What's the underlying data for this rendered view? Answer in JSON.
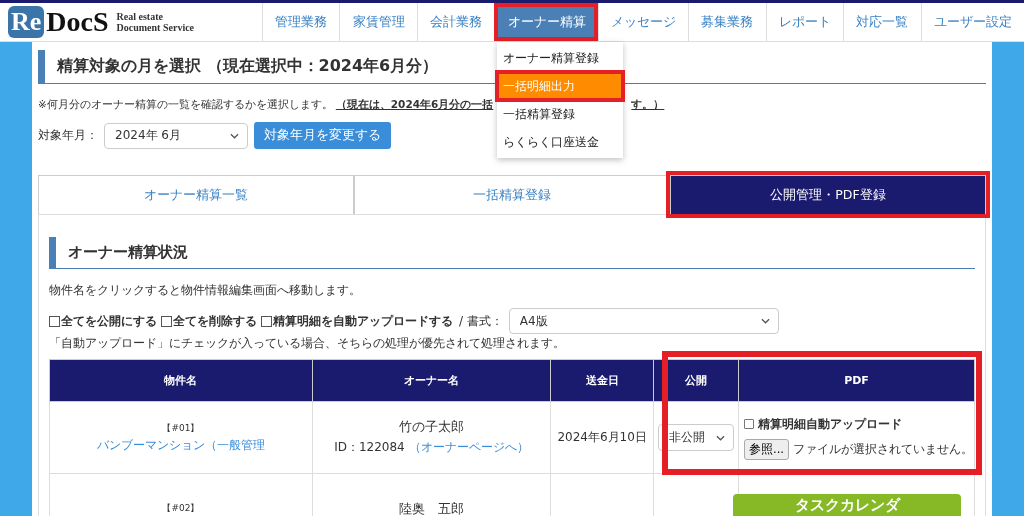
{
  "header": {
    "logo_mark": "Re",
    "logo_name": "DocS",
    "tagline_1": "Real estate",
    "tagline_2": "Document Service",
    "nav": [
      {
        "label": "管理業務",
        "selected": false,
        "highlighted": false
      },
      {
        "label": "家賃管理",
        "selected": false,
        "highlighted": false
      },
      {
        "label": "会計業務",
        "selected": false,
        "highlighted": false
      },
      {
        "label": "オーナー精算",
        "selected": true,
        "highlighted": true
      },
      {
        "label": "メッセージ",
        "selected": false,
        "highlighted": false
      },
      {
        "label": "募集業務",
        "selected": false,
        "highlighted": false
      },
      {
        "label": "レポート",
        "selected": false,
        "highlighted": false
      },
      {
        "label": "対応一覧",
        "selected": false,
        "highlighted": false
      },
      {
        "label": "ユーザー設定",
        "selected": false,
        "highlighted": false
      }
    ]
  },
  "dropdown": {
    "items": [
      {
        "label": "オーナー精算登録",
        "selected": false,
        "highlighted": false
      },
      {
        "label": "一括明細出力",
        "selected": true,
        "highlighted": true
      },
      {
        "label": "一括精算登録",
        "selected": false,
        "highlighted": false
      },
      {
        "label": "らくらく口座送金",
        "selected": false,
        "highlighted": false
      }
    ]
  },
  "month_section": {
    "title": "精算対象の月を選択 （現在選択中：2024年6月分）",
    "notice": "※何月分のオーナー精算の一覧を確認するかを選択します。",
    "notice_emphasis_start": "（現在は、2024年6月分の一括",
    "notice_emphasis_end": "す。）",
    "field_label": "対象年月：",
    "month_value": "2024年 6月",
    "change_button": "対象年月を変更する"
  },
  "tabs": [
    {
      "label": "オーナー精算一覧",
      "selected": false,
      "highlighted": false
    },
    {
      "label": "一括精算登録",
      "selected": false,
      "highlighted": false
    },
    {
      "label": "公開管理・PDF登録",
      "selected": true,
      "highlighted": true
    }
  ],
  "status_section": {
    "title": "オーナー精算状況",
    "hint": "物件名をクリックすると物件情報編集画面へ移動します。",
    "options": [
      {
        "label": "全てを公開にする",
        "checked": false
      },
      {
        "label": "全てを削除する",
        "checked": false
      },
      {
        "label": "精算明細を自動アップロードする",
        "checked": false
      }
    ],
    "format_label": "/ 書式：",
    "format_value": "A4版",
    "note": "「自動アップロード」にチェックが入っている場合、そちらの処理が優先されて処理されます。"
  },
  "table": {
    "highlight_frame": true,
    "columns": [
      "物件名",
      "オーナー名",
      "送金日",
      "公開",
      "PDF"
    ],
    "rows": [
      {
        "number": "【#01】",
        "property": "バンブーマンション（一般管理",
        "owner": "竹の子太郎",
        "owner_id": "ID：122084",
        "owner_link": "（オーナーページへ）",
        "date": "2024年6月10日",
        "visibility": "非公開",
        "auto_upload_label": "精算明細自動アップロード",
        "auto_upload": false,
        "browse_button": "参照...",
        "file_status": "ファイルが選択されていません。"
      },
      {
        "number": "【#02】",
        "owner": "陸奥　五郎"
      }
    ]
  },
  "floating_button": "タスクカレンダ"
}
